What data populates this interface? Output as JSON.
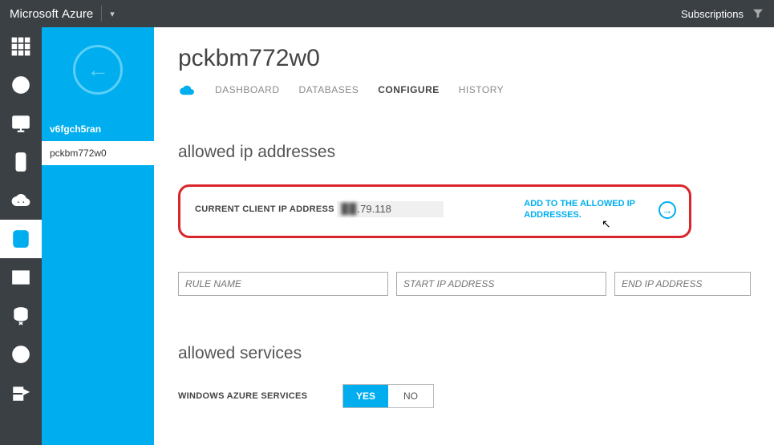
{
  "topbar": {
    "brand_light": "Microsoft",
    "brand_bold": "Azure",
    "subscriptions": "Subscriptions"
  },
  "context": {
    "items": [
      "v6fgch5ran",
      "pckbm772w0"
    ]
  },
  "page": {
    "title": "pckbm772w0"
  },
  "tabs": {
    "dashboard": "DASHBOARD",
    "databases": "DATABASES",
    "configure": "CONFIGURE",
    "history": "HISTORY"
  },
  "allowed_ip": {
    "section_title": "allowed ip addresses",
    "client_label": "CURRENT CLIENT IP ADDRESS",
    "ip_hidden": "▉▉",
    "ip_visible": ".79.118",
    "add_link": "ADD TO THE ALLOWED IP ADDRESSES.",
    "rule_ph": "RULE NAME",
    "start_ph": "START IP ADDRESS",
    "end_ph": "END IP ADDRESS"
  },
  "allowed_services": {
    "section_title": "allowed services",
    "label": "WINDOWS AZURE SERVICES",
    "yes": "YES",
    "no": "NO"
  }
}
